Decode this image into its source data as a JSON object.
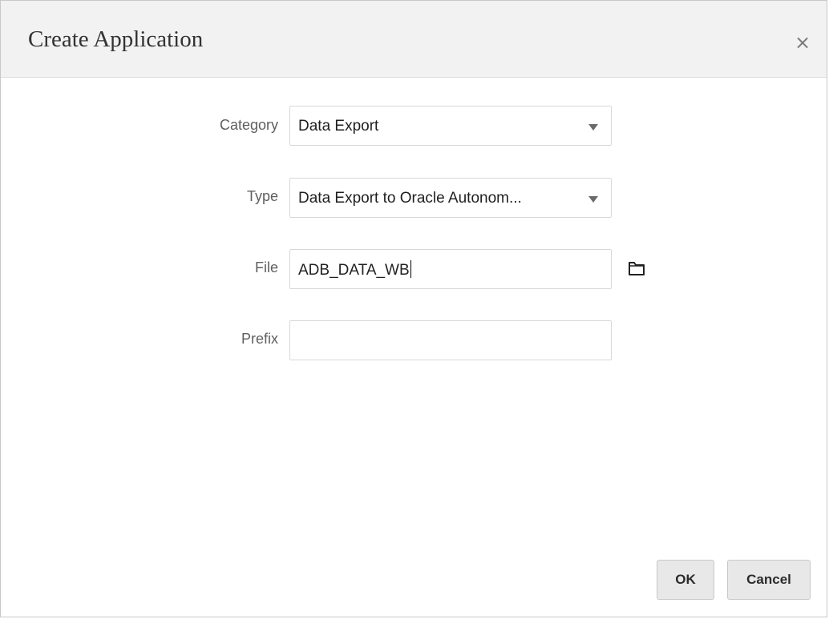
{
  "dialog": {
    "title": "Create Application",
    "close_glyph": "×"
  },
  "form": {
    "category": {
      "label": "Category",
      "value": "Data Export"
    },
    "type": {
      "label": "Type",
      "value": "Data Export to Oracle Autonom..."
    },
    "file": {
      "label": "File",
      "value": "ADB_DATA_WB",
      "browse_icon": "folder-icon"
    },
    "prefix": {
      "label": "Prefix",
      "value": ""
    }
  },
  "buttons": {
    "ok": "OK",
    "cancel": "Cancel"
  }
}
